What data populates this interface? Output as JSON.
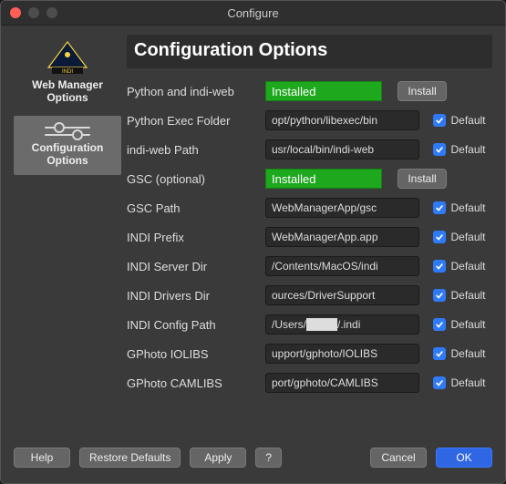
{
  "window": {
    "title": "Configure"
  },
  "sidebar": {
    "items": [
      {
        "label": "Web Manager Options"
      },
      {
        "label": "Configuration Options"
      }
    ]
  },
  "main": {
    "title": "Configuration Options",
    "rows": [
      {
        "label": "Python and indi-web",
        "kind": "status",
        "value": "Installed",
        "action": "Install"
      },
      {
        "label": "Python Exec Folder",
        "kind": "input",
        "value": "opt/python/libexec/bin",
        "default_label": "Default"
      },
      {
        "label": "indi-web Path",
        "kind": "input",
        "value": "usr/local/bin/indi-web",
        "default_label": "Default"
      },
      {
        "label": "GSC (optional)",
        "kind": "status",
        "value": "Installed",
        "action": "Install"
      },
      {
        "label": "GSC Path",
        "kind": "input",
        "value": "WebManagerApp/gsc",
        "default_label": "Default"
      },
      {
        "label": "INDI Prefix",
        "kind": "input",
        "value": "WebManagerApp.app",
        "default_label": "Default"
      },
      {
        "label": "INDI Server Dir",
        "kind": "input",
        "value": "/Contents/MacOS/indi",
        "default_label": "Default"
      },
      {
        "label": "INDI Drivers Dir",
        "kind": "input",
        "value": "ources/DriverSupport",
        "default_label": "Default"
      },
      {
        "label": "INDI Config Path",
        "kind": "input",
        "value": "/Users/████/.indi",
        "default_label": "Default"
      },
      {
        "label": "GPhoto IOLIBS",
        "kind": "input",
        "value": "upport/gphoto/IOLIBS",
        "default_label": "Default"
      },
      {
        "label": "GPhoto CAMLIBS",
        "kind": "input",
        "value": "port/gphoto/CAMLIBS",
        "default_label": "Default"
      }
    ]
  },
  "footer": {
    "help": "Help",
    "restore": "Restore Defaults",
    "apply": "Apply",
    "question": "?",
    "cancel": "Cancel",
    "ok": "OK"
  }
}
